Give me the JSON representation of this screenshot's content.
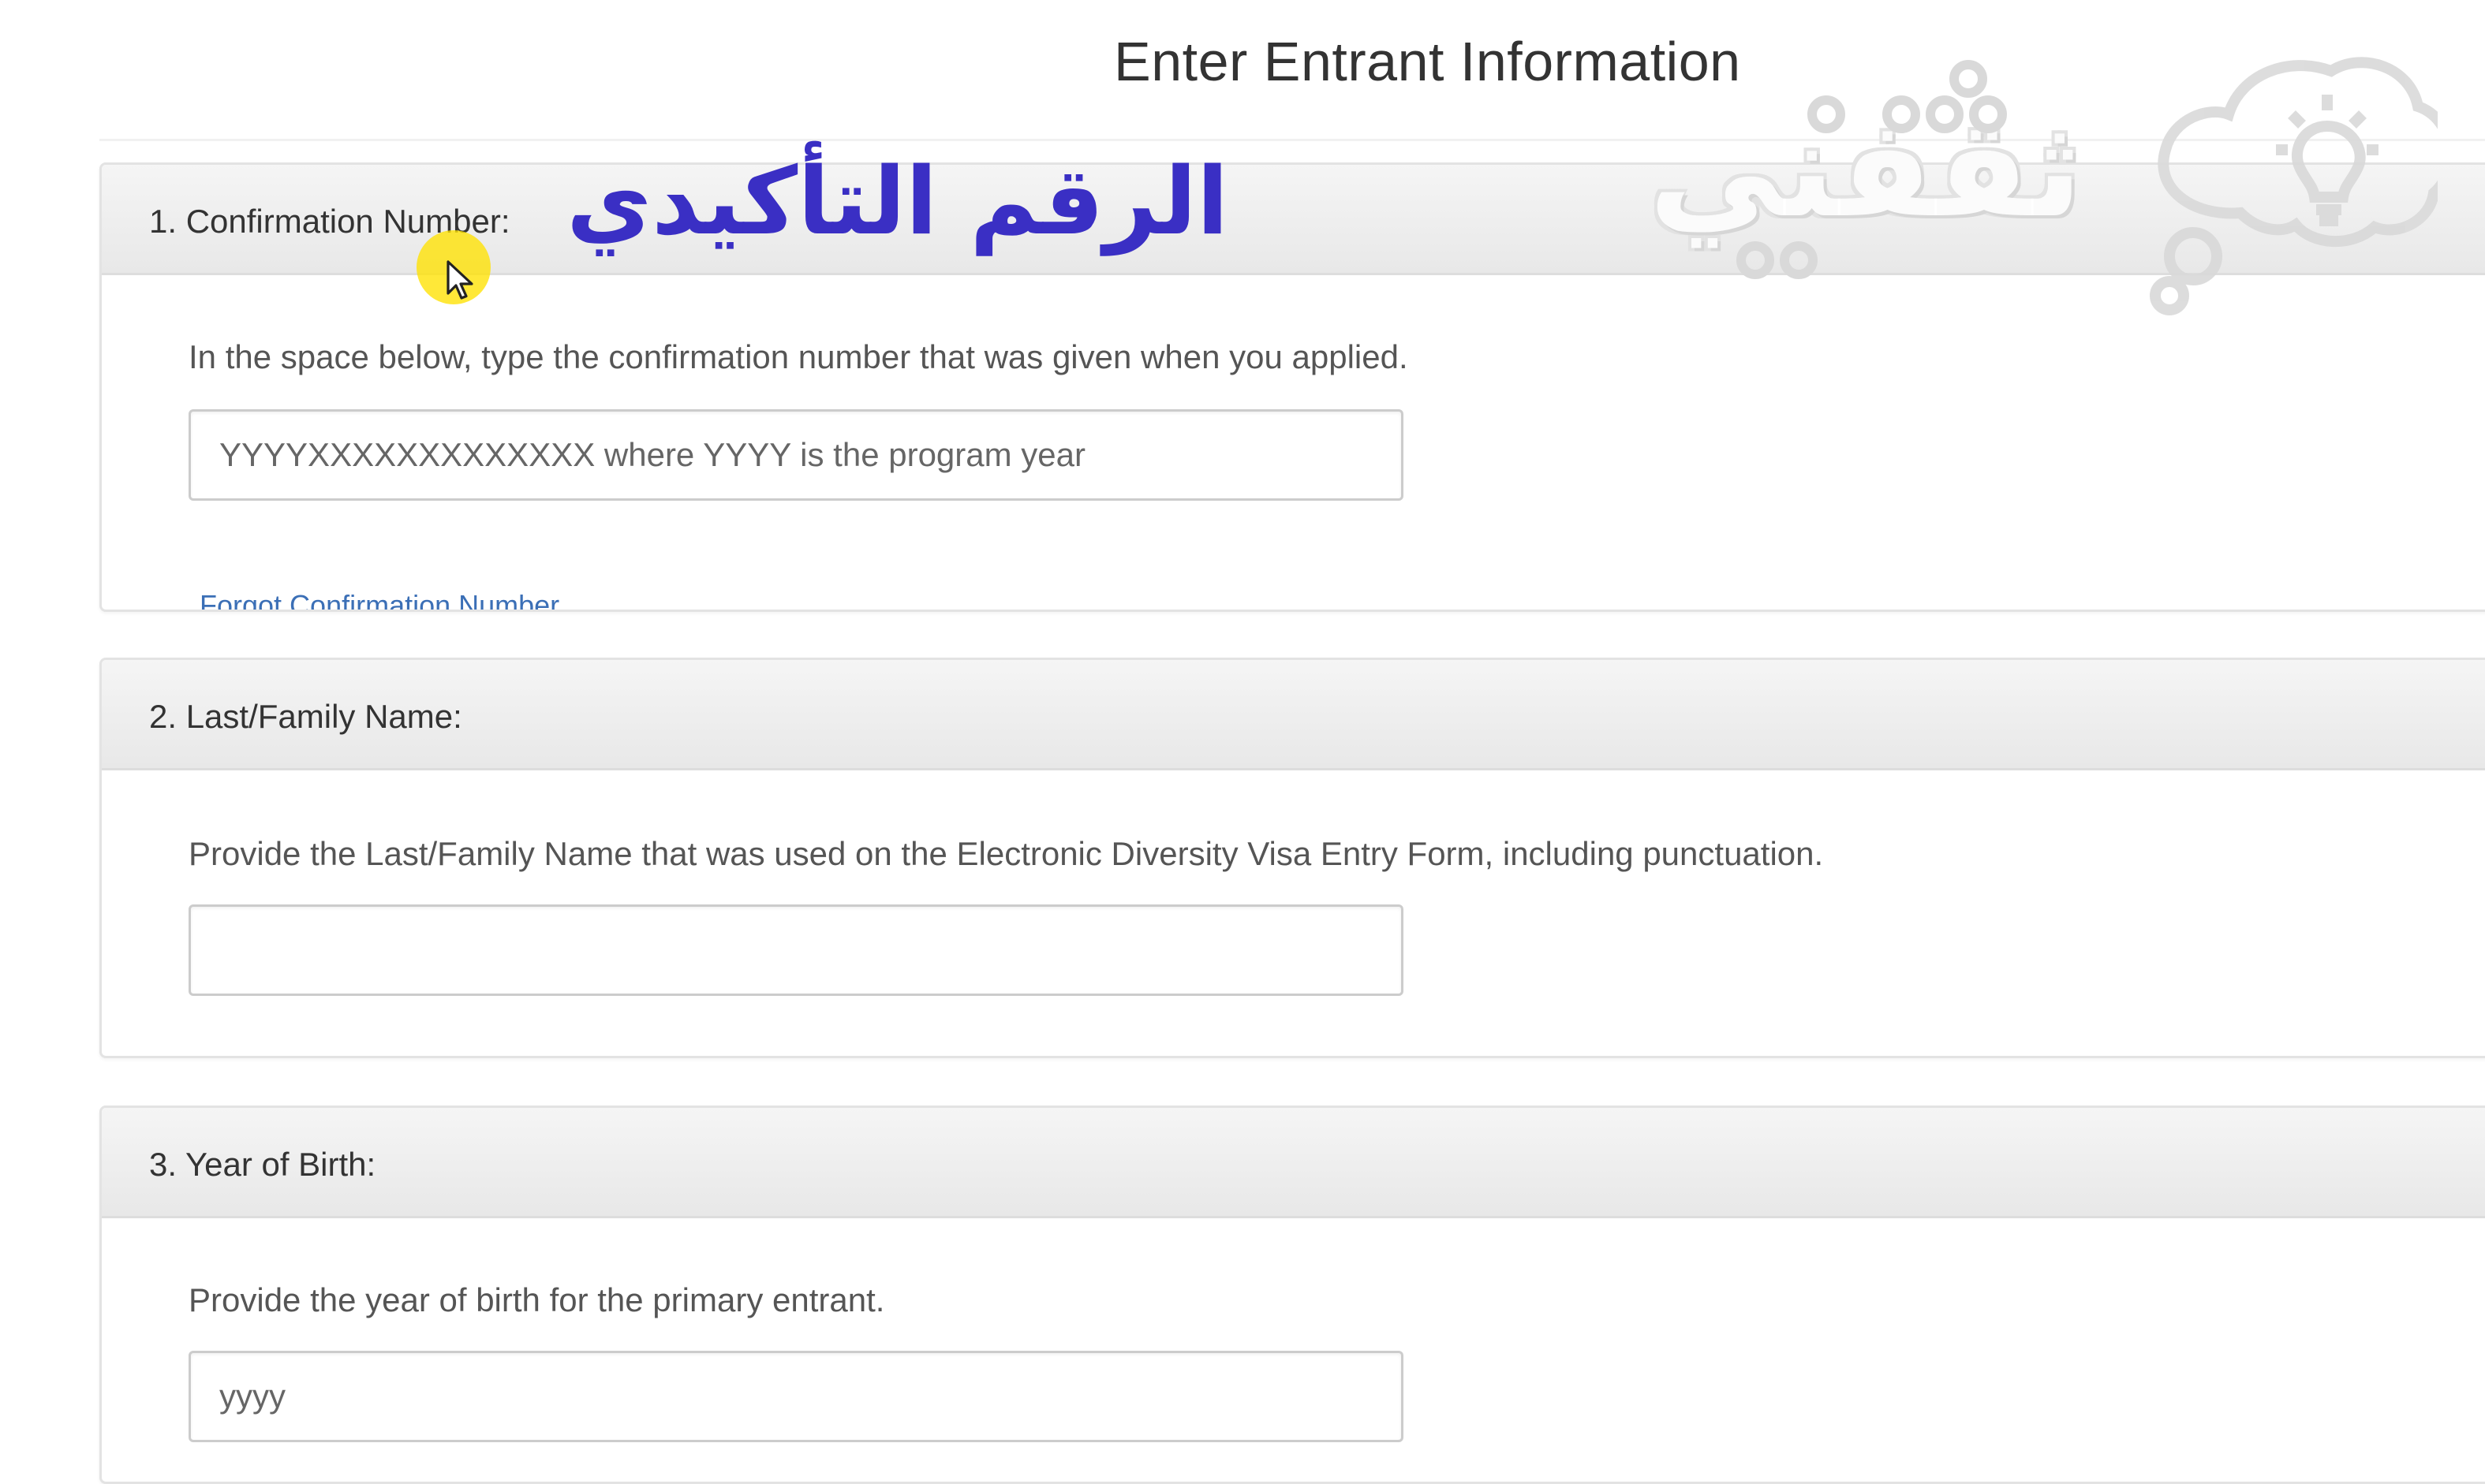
{
  "page": {
    "title": "Enter Entrant Information"
  },
  "sections": [
    {
      "label": "1. Confirmation Number:",
      "description": "In the space below, type the confirmation number that was given when you applied.",
      "input_placeholder": "YYYYXXXXXXXXXXXXX where YYYY is the program year",
      "input_value": "",
      "link_label": "Forgot Confirmation Number"
    },
    {
      "label": "2. Last/Family Name:",
      "description": "Provide the Last/Family Name that was used on the Electronic Diversity Visa Entry Form, including punctuation.",
      "input_placeholder": "",
      "input_value": ""
    },
    {
      "label": "3. Year of Birth:",
      "description": "Provide the year of birth for the primary entrant.",
      "input_placeholder": "yyyy",
      "input_value": ""
    }
  ],
  "overlay": {
    "arabic_caption": "الرقم التأكيدي",
    "caption_color": "#3a2fc4",
    "watermark_text": "ثقفني"
  },
  "colors": {
    "link": "#3b6fb6",
    "cursor_highlight": "#ffe200"
  },
  "icons": {
    "cursor": "mouse-pointer-icon",
    "watermark_logo": "lightbulb-cloud-icon"
  }
}
